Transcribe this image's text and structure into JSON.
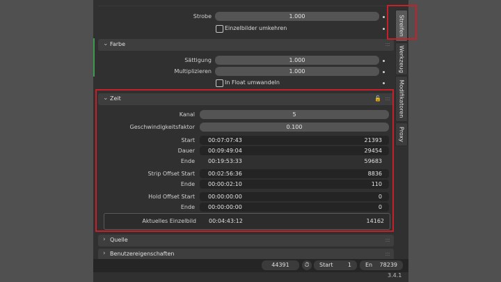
{
  "strobe": {
    "label": "Strobe",
    "value": "1.000",
    "reverse_label": "Einzelbilder umkehren"
  },
  "farbe": {
    "title": "Farbe",
    "saturation_label": "Sättigung",
    "saturation_value": "1.000",
    "multiply_label": "Multiplizieren",
    "multiply_value": "1.000",
    "float_label": "In Float umwandeln"
  },
  "zeit": {
    "title": "Zeit",
    "channel_label": "Kanal",
    "channel_value": "5",
    "speed_label": "Geschwindigkeitsfaktor",
    "speed_value": "0.100",
    "start_label": "Start",
    "start_time": "00:07:07:43",
    "start_frame": "21393",
    "duration_label": "Dauer",
    "duration_time": "00:09:49:04",
    "duration_frame": "29454",
    "end_label": "Ende",
    "end_time": "00:19:53:33",
    "end_frame": "59683",
    "strip_offset_start_label": "Strip Offset Start",
    "strip_offset_start_time": "00:02:56:36",
    "strip_offset_start_frame": "8836",
    "strip_offset_end_label": "Ende",
    "strip_offset_end_time": "00:00:02:10",
    "strip_offset_end_frame": "110",
    "hold_offset_start_label": "Hold Offset Start",
    "hold_offset_start_time": "00:00:00:00",
    "hold_offset_start_frame": "0",
    "hold_offset_end_label": "Ende",
    "hold_offset_end_time": "00:00:00:00",
    "hold_offset_end_frame": "0",
    "current_frame_label": "Aktuelles Einzelbild",
    "current_frame_time": "00:04:43:12",
    "current_frame_value": "14162"
  },
  "collapsed": {
    "source": "Quelle",
    "custom_props": "Benutzereigenschaften"
  },
  "tabs": [
    "Streifen",
    "Werkzeug",
    "Modifikatoren",
    "Proxy"
  ],
  "footer": {
    "current_frame": "44391",
    "start_label": "Start",
    "start_value": "1",
    "end_label": "En",
    "end_value": "78239"
  },
  "version": "3.4.1"
}
